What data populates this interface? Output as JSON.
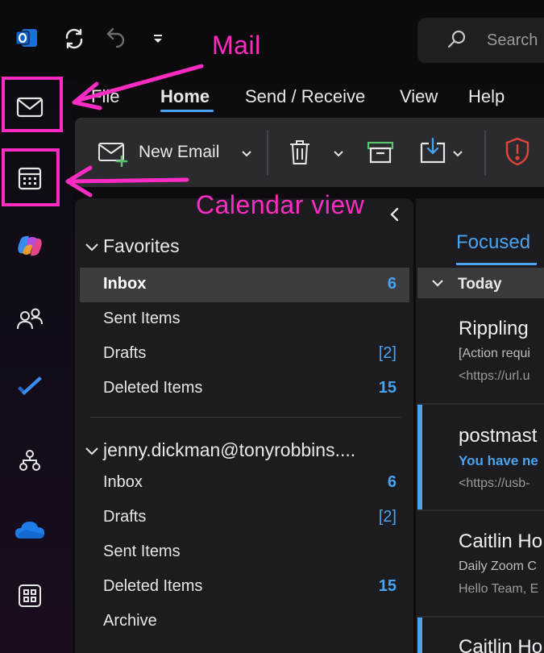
{
  "titlebar": {
    "search_placeholder": "Search"
  },
  "menu": {
    "tabs": [
      {
        "label": "File"
      },
      {
        "label": "Home",
        "active": true
      },
      {
        "label": "Send / Receive"
      },
      {
        "label": "View"
      },
      {
        "label": "Help"
      }
    ]
  },
  "ribbon": {
    "new_email_label": "New Email"
  },
  "annotations": {
    "mail_label": "Mail",
    "calendar_label": "Calendar view",
    "color": "#ff2bc2"
  },
  "rail": {
    "items": [
      "mail-icon",
      "calendar-icon",
      "copilot-icon",
      "people-icon",
      "todo-icon",
      "org-chart-icon",
      "onedrive-icon",
      "apps-icon"
    ]
  },
  "folders": {
    "favorites": {
      "header": "Favorites",
      "items": [
        {
          "label": "Inbox",
          "count": "6",
          "selected": true
        },
        {
          "label": "Sent Items",
          "count": ""
        },
        {
          "label": "Drafts",
          "count": "[2]"
        },
        {
          "label": "Deleted Items",
          "count": "15"
        }
      ]
    },
    "account": {
      "header": "jenny.dickman@tonyrobbins....",
      "items": [
        {
          "label": "Inbox",
          "count": "6"
        },
        {
          "label": "Drafts",
          "count": "[2]"
        },
        {
          "label": "Sent Items",
          "count": ""
        },
        {
          "label": "Deleted Items",
          "count": "15"
        },
        {
          "label": "Archive",
          "count": ""
        }
      ]
    }
  },
  "messages": {
    "tab": "Focused",
    "group": "Today",
    "items": [
      {
        "sender": "Rippling",
        "line1": "[Action requi",
        "line2": "<https://url.u"
      },
      {
        "sender": "postmast",
        "line1": "You have ne",
        "line2": "<https://usb-"
      },
      {
        "sender": "Caitlin Ho",
        "line1": "Daily Zoom C",
        "line2": "Hello Team, E"
      },
      {
        "sender": "Caitlin Ho",
        "line1": "",
        "line2": ""
      }
    ]
  },
  "colors": {
    "accent": "#4aa3f0",
    "annotation": "#ff2bc2"
  }
}
